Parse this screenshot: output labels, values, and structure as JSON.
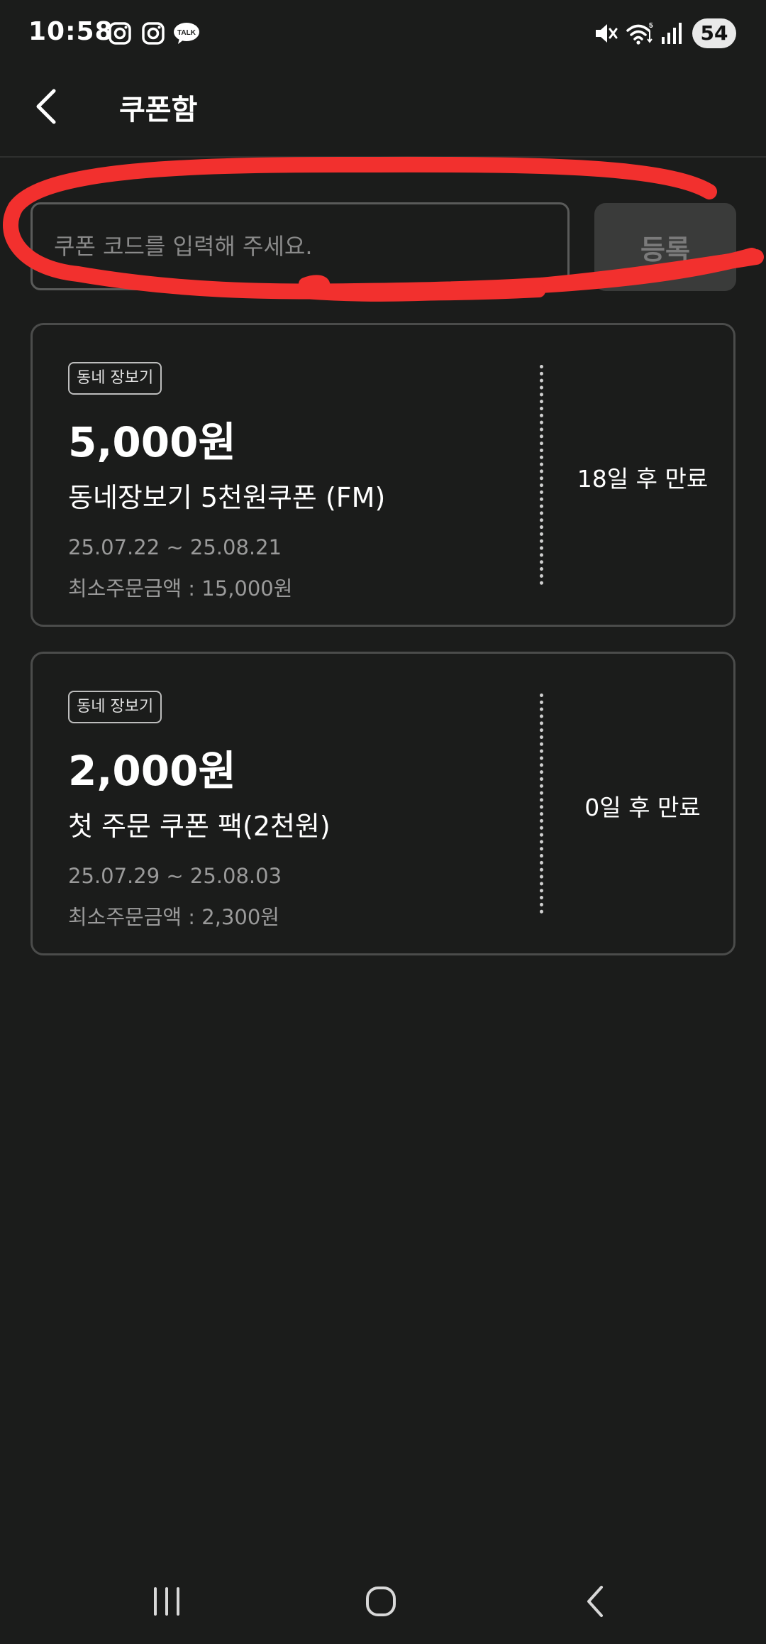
{
  "status_bar": {
    "time": "10:58",
    "apps": [
      "instagram-icon",
      "instagram-icon",
      "kakaotalk-icon"
    ],
    "kakaotalk_label": "TALK",
    "battery_level": "54"
  },
  "header": {
    "title": "쿠폰함"
  },
  "coupon_form": {
    "placeholder": "쿠폰 코드를 입력해 주세요.",
    "value": "",
    "register_label": "등록",
    "highlight_color": "#f2302e"
  },
  "coupons": [
    {
      "tag": "동네 장보기",
      "amount": "5,000원",
      "name": "동네장보기 5천원쿠폰 (FM)",
      "period": "25.07.22 ~ 25.08.21",
      "min_order": "최소주문금액 : 15,000원",
      "expiry": "18일 후 만료"
    },
    {
      "tag": "동네 장보기",
      "amount": "2,000원",
      "name": "첫 주문 쿠폰 팩(2천원)",
      "period": "25.07.29 ~ 25.08.03",
      "min_order": "최소주문금액 : 2,300원",
      "expiry": "0일 후 만료"
    }
  ],
  "nav_bar": {
    "buttons": [
      "recent-apps-icon",
      "home-icon",
      "back-icon"
    ]
  }
}
